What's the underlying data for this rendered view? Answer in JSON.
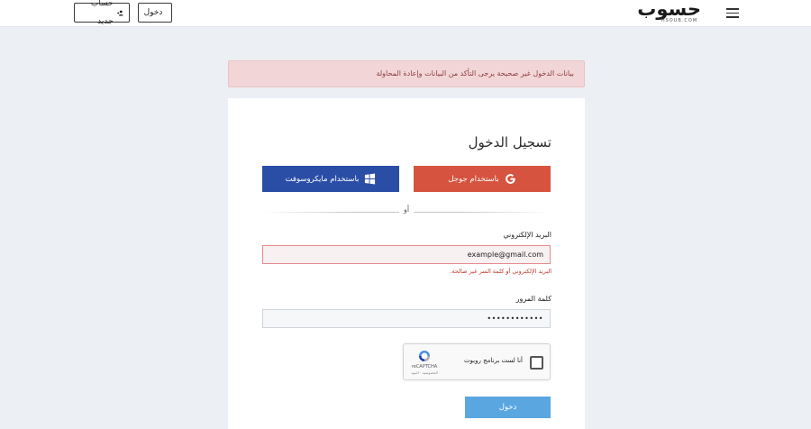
{
  "nav": {
    "register_label": "حساب جديد",
    "login_label": "دخول",
    "logo_text": "حسوب",
    "logo_sub": "HSOUB.COM"
  },
  "alert": {
    "message": "بيانات الدخول غير صحيحة يرجى التأكد من البيانات وإعادة المحاولة"
  },
  "form": {
    "title": "تسجيل الدخول",
    "google_label": "باستخدام جوجل",
    "microsoft_label": "باستخدام مايكروسوفت",
    "or_label": "أو",
    "email_label": "البريد الإلكتروني",
    "email_value": "example@gmail.com",
    "email_error": "البريد الإلكتروني أو كلمة السر غير صالحة.",
    "password_label": "كلمة المرور",
    "password_value": "••••••••••••",
    "submit_label": "دخول"
  },
  "recaptcha": {
    "label": "أنا لست برنامج روبوت",
    "brand": "reCAPTCHA",
    "terms": "الخصوصية - البنود"
  },
  "colors": {
    "google": "#d5533f",
    "microsoft": "#2a4ea6",
    "submit": "#5aa6e0",
    "alert_bg": "#f2d6d7",
    "error_text": "#c0392b"
  }
}
